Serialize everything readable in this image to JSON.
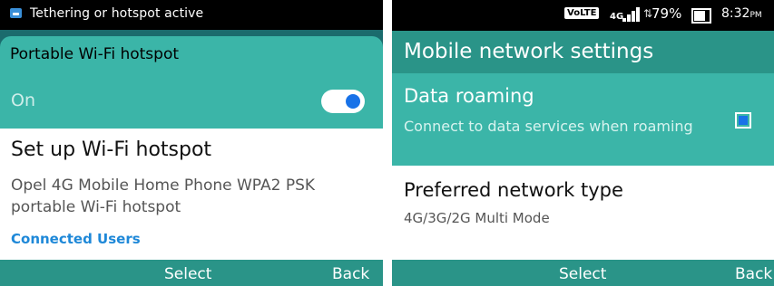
{
  "left_screen": {
    "status_text": "Tethering or hotspot active",
    "hotspot_title": "Portable Wi-Fi hotspot",
    "toggle_label": "On",
    "toggle_state": "on",
    "setup_title": "Set up Wi-Fi hotspot",
    "setup_desc": "Opel 4G Mobile Home Phone WPA2 PSK portable Wi-Fi hotspot",
    "connected_users": "Connected Users",
    "softkeys": {
      "select": "Select",
      "back": "Back"
    }
  },
  "right_screen": {
    "status": {
      "volte": "VoLTE",
      "network": "4G",
      "battery": "79%",
      "time": "8:32",
      "ampm": "PM"
    },
    "header_title": "Mobile network settings",
    "roaming_title": "Data roaming",
    "roaming_desc": "Connect to data services when roaming",
    "roaming_checked": false,
    "pref_title": "Preferred network type",
    "pref_value": "4G/3G/2G Multi Mode",
    "softkeys": {
      "select": "Select",
      "back": "Back"
    }
  },
  "icons": {
    "notification": "notification-icon",
    "signal": "signal-strength-icon",
    "battery": "battery-icon",
    "toggle": "toggle-switch",
    "checkbox": "checkbox"
  },
  "colors": {
    "teal": "#3bb5a8",
    "teal_dark": "#2a9488",
    "accent_blue": "#1872e8",
    "link_blue": "#1e88d8"
  }
}
